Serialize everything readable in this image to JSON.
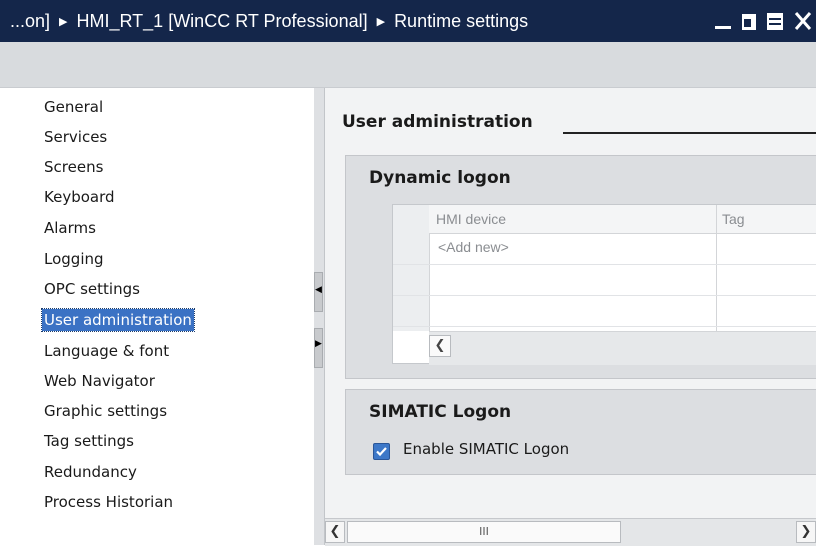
{
  "titlebar": {
    "path": [
      "...on]",
      "HMI_RT_1 [WinCC RT Professional]",
      "Runtime settings"
    ],
    "minimize_icon": "minimize-icon",
    "restore_icon": "float-window-icon",
    "maximize_icon": "maximize-icon",
    "close_icon": "close-icon"
  },
  "nav": {
    "items": [
      {
        "label": "General"
      },
      {
        "label": "Services"
      },
      {
        "label": "Screens"
      },
      {
        "label": "Keyboard"
      },
      {
        "label": "Alarms"
      },
      {
        "label": "Logging"
      },
      {
        "label": "OPC settings"
      },
      {
        "label": "User administration",
        "selected": true
      },
      {
        "label": "Language & font"
      },
      {
        "label": "Web Navigator"
      },
      {
        "label": "Graphic settings"
      },
      {
        "label": "Tag settings"
      },
      {
        "label": "Redundancy"
      },
      {
        "label": "Process Historian"
      }
    ]
  },
  "content": {
    "section_title": "User administration",
    "dynamic_logon": {
      "title": "Dynamic logon",
      "columns": [
        "HMI device",
        "Tag"
      ],
      "add_new": "<Add new>",
      "scroll_left_icon": "chevron-left-icon"
    },
    "simatic_logon": {
      "title": "SIMATIC Logon",
      "checkbox_label": "Enable SIMATIC Logon",
      "checked": true
    }
  },
  "bottom_scroll": {
    "left_icon": "chevron-left-icon",
    "thumb_grip": "III",
    "right_icon": "chevron-right-icon"
  },
  "colors": {
    "titlebar_bg": "#14264a",
    "selection": "#3b72c4",
    "panel_bg": "#f2f3f4",
    "group_bg": "#dcdee1"
  }
}
